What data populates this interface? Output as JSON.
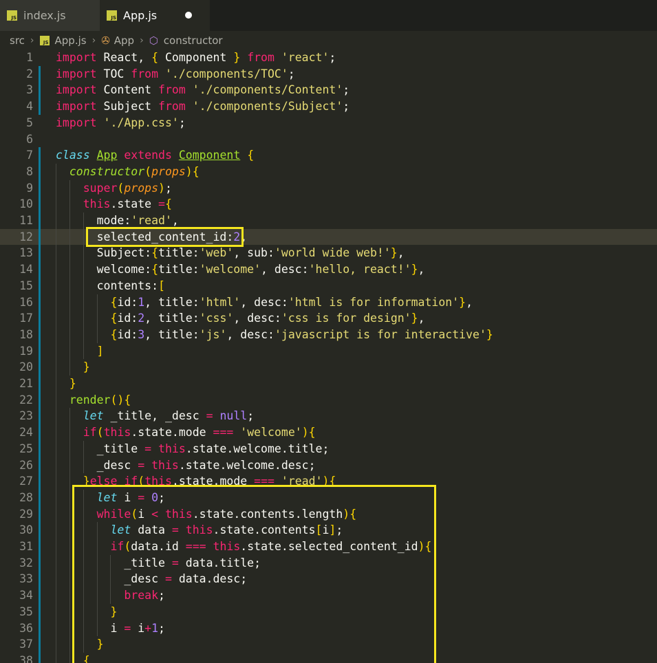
{
  "tabs": [
    {
      "label": "index.js",
      "icon": "js-file-icon",
      "active": false
    },
    {
      "label": "App.js",
      "icon": "js-file-icon",
      "active": true,
      "unsaved": true
    }
  ],
  "breadcrumb": {
    "folder": "src",
    "file": "App.js",
    "class": "App",
    "member": "constructor"
  },
  "line_numbers": [
    "1",
    "2",
    "3",
    "4",
    "5",
    "6",
    "7",
    "8",
    "9",
    "10",
    "11",
    "12",
    "13",
    "14",
    "15",
    "16",
    "17",
    "18",
    "19",
    "20",
    "21",
    "22",
    "23",
    "24",
    "25",
    "26",
    "27",
    "28",
    "29",
    "30",
    "31",
    "32",
    "33",
    "34",
    "35",
    "36",
    "37",
    "38"
  ],
  "code_lines": [
    "import React, { Component } from 'react';",
    "import TOC from './components/TOC';",
    "import Content from './components/Content';",
    "import Subject from './components/Subject';",
    "import './App.css';",
    "",
    "class App extends Component {",
    "  constructor(props){",
    "    super(props);",
    "    this.state ={",
    "      mode:'read',",
    "      selected_content_id:2,",
    "      Subject:{title:'web', sub:'world wide web!'},",
    "      welcome:{title:'welcome', desc:'hello, react!'},",
    "      contents:[",
    "        {id:1, title:'html', desc:'html is for information'},",
    "        {id:2, title:'css', desc:'css is for design'},",
    "        {id:3, title:'js', desc:'javascript is for interactive'}",
    "      ]",
    "    }",
    "  }",
    "  render(){",
    "    let _title, _desc = null;",
    "    if(this.state.mode === 'welcome'){",
    "      _title = this.state.welcome.title;",
    "      _desc = this.state.welcome.desc;",
    "    }else if(this.state.mode === 'read'){",
    "      let i = 0;",
    "      while(i < this.state.contents.length){",
    "        let data = this.state.contents[i];",
    "        if(data.id === this.state.selected_content_id){",
    "          _title = data.title;",
    "          _desc = data.desc;",
    "          break;",
    "        }",
    "        i = i+1;",
    "      }",
    "    {"
  ],
  "colors": {
    "background": "#272822",
    "keyword": "#f92672",
    "string": "#e6db74",
    "number": "#ae81ff",
    "class_name": "#a6e22e",
    "parameter": "#fd971f",
    "annotation_box": "#f5e61e"
  }
}
